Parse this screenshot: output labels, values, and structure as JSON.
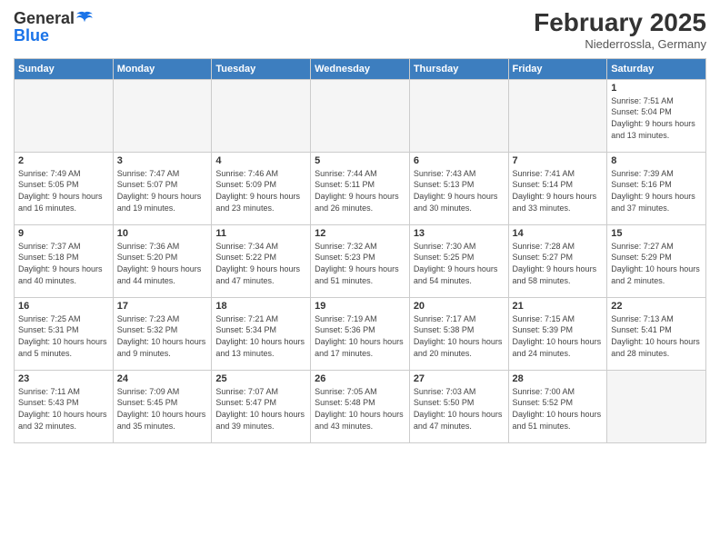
{
  "header": {
    "logo": {
      "line1": "General",
      "line2": "Blue"
    },
    "title": "February 2025",
    "location": "Niederrossla, Germany"
  },
  "weekdays": [
    "Sunday",
    "Monday",
    "Tuesday",
    "Wednesday",
    "Thursday",
    "Friday",
    "Saturday"
  ],
  "weeks": [
    [
      {
        "day": "",
        "empty": true
      },
      {
        "day": "",
        "empty": true
      },
      {
        "day": "",
        "empty": true
      },
      {
        "day": "",
        "empty": true
      },
      {
        "day": "",
        "empty": true
      },
      {
        "day": "",
        "empty": true
      },
      {
        "day": "1",
        "sunrise": "7:51 AM",
        "sunset": "5:04 PM",
        "daylight": "9 hours and 13 minutes."
      }
    ],
    [
      {
        "day": "2",
        "sunrise": "7:49 AM",
        "sunset": "5:05 PM",
        "daylight": "9 hours and 16 minutes."
      },
      {
        "day": "3",
        "sunrise": "7:47 AM",
        "sunset": "5:07 PM",
        "daylight": "9 hours and 19 minutes."
      },
      {
        "day": "4",
        "sunrise": "7:46 AM",
        "sunset": "5:09 PM",
        "daylight": "9 hours and 23 minutes."
      },
      {
        "day": "5",
        "sunrise": "7:44 AM",
        "sunset": "5:11 PM",
        "daylight": "9 hours and 26 minutes."
      },
      {
        "day": "6",
        "sunrise": "7:43 AM",
        "sunset": "5:13 PM",
        "daylight": "9 hours and 30 minutes."
      },
      {
        "day": "7",
        "sunrise": "7:41 AM",
        "sunset": "5:14 PM",
        "daylight": "9 hours and 33 minutes."
      },
      {
        "day": "8",
        "sunrise": "7:39 AM",
        "sunset": "5:16 PM",
        "daylight": "9 hours and 37 minutes."
      }
    ],
    [
      {
        "day": "9",
        "sunrise": "7:37 AM",
        "sunset": "5:18 PM",
        "daylight": "9 hours and 40 minutes."
      },
      {
        "day": "10",
        "sunrise": "7:36 AM",
        "sunset": "5:20 PM",
        "daylight": "9 hours and 44 minutes."
      },
      {
        "day": "11",
        "sunrise": "7:34 AM",
        "sunset": "5:22 PM",
        "daylight": "9 hours and 47 minutes."
      },
      {
        "day": "12",
        "sunrise": "7:32 AM",
        "sunset": "5:23 PM",
        "daylight": "9 hours and 51 minutes."
      },
      {
        "day": "13",
        "sunrise": "7:30 AM",
        "sunset": "5:25 PM",
        "daylight": "9 hours and 54 minutes."
      },
      {
        "day": "14",
        "sunrise": "7:28 AM",
        "sunset": "5:27 PM",
        "daylight": "9 hours and 58 minutes."
      },
      {
        "day": "15",
        "sunrise": "7:27 AM",
        "sunset": "5:29 PM",
        "daylight": "10 hours and 2 minutes."
      }
    ],
    [
      {
        "day": "16",
        "sunrise": "7:25 AM",
        "sunset": "5:31 PM",
        "daylight": "10 hours and 5 minutes."
      },
      {
        "day": "17",
        "sunrise": "7:23 AM",
        "sunset": "5:32 PM",
        "daylight": "10 hours and 9 minutes."
      },
      {
        "day": "18",
        "sunrise": "7:21 AM",
        "sunset": "5:34 PM",
        "daylight": "10 hours and 13 minutes."
      },
      {
        "day": "19",
        "sunrise": "7:19 AM",
        "sunset": "5:36 PM",
        "daylight": "10 hours and 17 minutes."
      },
      {
        "day": "20",
        "sunrise": "7:17 AM",
        "sunset": "5:38 PM",
        "daylight": "10 hours and 20 minutes."
      },
      {
        "day": "21",
        "sunrise": "7:15 AM",
        "sunset": "5:39 PM",
        "daylight": "10 hours and 24 minutes."
      },
      {
        "day": "22",
        "sunrise": "7:13 AM",
        "sunset": "5:41 PM",
        "daylight": "10 hours and 28 minutes."
      }
    ],
    [
      {
        "day": "23",
        "sunrise": "7:11 AM",
        "sunset": "5:43 PM",
        "daylight": "10 hours and 32 minutes."
      },
      {
        "day": "24",
        "sunrise": "7:09 AM",
        "sunset": "5:45 PM",
        "daylight": "10 hours and 35 minutes."
      },
      {
        "day": "25",
        "sunrise": "7:07 AM",
        "sunset": "5:47 PM",
        "daylight": "10 hours and 39 minutes."
      },
      {
        "day": "26",
        "sunrise": "7:05 AM",
        "sunset": "5:48 PM",
        "daylight": "10 hours and 43 minutes."
      },
      {
        "day": "27",
        "sunrise": "7:03 AM",
        "sunset": "5:50 PM",
        "daylight": "10 hours and 47 minutes."
      },
      {
        "day": "28",
        "sunrise": "7:00 AM",
        "sunset": "5:52 PM",
        "daylight": "10 hours and 51 minutes."
      },
      {
        "day": "",
        "empty": true
      }
    ]
  ]
}
